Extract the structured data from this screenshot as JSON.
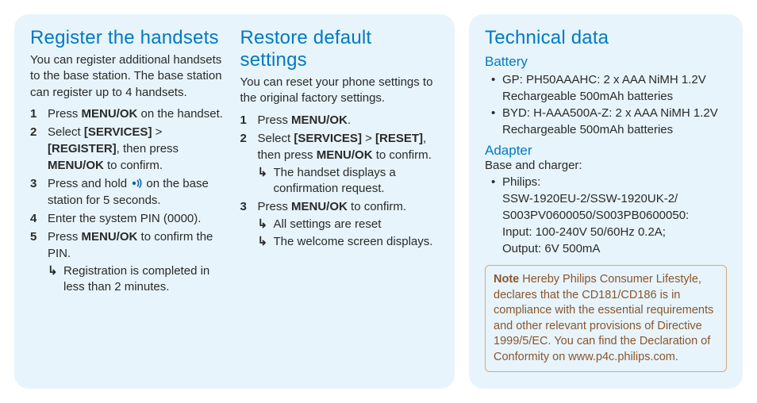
{
  "left": {
    "register": {
      "heading": "Register the handsets",
      "intro": "You can register additional handsets to the base station. The base station can register up to 4 handsets.",
      "steps": [
        {
          "num": "1",
          "pre": "Press ",
          "strong": "MENU/OK",
          "post": " on the handset."
        },
        {
          "num": "2",
          "full_html": "Select <span class=\"b\">[SERVICES]</span> > <span class=\"b\">[REGISTER]</span>, then press <span class=\"b\">MENU/OK</span> to confirm."
        },
        {
          "num": "3",
          "pre": "Press and hold ",
          "icon": "signal-icon",
          "post": " on the base station for 5 seconds."
        },
        {
          "num": "4",
          "plain": "Enter the system PIN (0000)."
        },
        {
          "num": "5",
          "pre": "Press ",
          "strong": "MENU/OK",
          "post": " to confirm the PIN."
        }
      ],
      "result": "Registration is completed in less than 2 minutes."
    },
    "restore": {
      "heading": "Restore default settings",
      "intro": "You can reset your phone settings to the original factory settings.",
      "steps": [
        {
          "num": "1",
          "pre": "Press ",
          "strong": "MENU/OK",
          "post": "."
        },
        {
          "num": "2",
          "full_html": "Select <span class=\"b\">[SERVICES]</span> > <span class=\"b\">[RESET]</span>, then press <span class=\"b\">MENU/OK</span> to confirm."
        }
      ],
      "sub1": "The handset displays a confirmation request.",
      "step3": {
        "num": "3",
        "pre": "Press ",
        "strong": "MENU/OK",
        "post": " to confirm."
      },
      "sub2": "All settings are reset",
      "sub3": "The welcome screen displays."
    }
  },
  "right": {
    "heading": "Technical data",
    "battery": {
      "label": "Battery",
      "items": [
        "GP: PH50AAAHC: 2 x AAA NiMH 1.2V Rechargeable 500mAh batteries",
        "BYD: H-AAA500A-Z: 2 x AAA NiMH 1.2V Rechargeable 500mAh batteries"
      ]
    },
    "adapter": {
      "label": "Adapter",
      "sub": "Base and charger:",
      "item": "Philips:\nSSW-1920EU-2/SSW-1920UK-2/\nS003PV0600050/S003PB0600050:\nInput: 100-240V 50/60Hz 0.2A;\nOutput: 6V 500mA"
    },
    "note": {
      "label": "Note",
      "text": " Hereby Philips Consumer Lifestyle, declares that the CD181/CD186 is in compliance with the essential requirements and other relevant provisions of Directive 1999/5/EC. You can find the Declaration of Conformity on www.p4c.philips.com."
    }
  }
}
